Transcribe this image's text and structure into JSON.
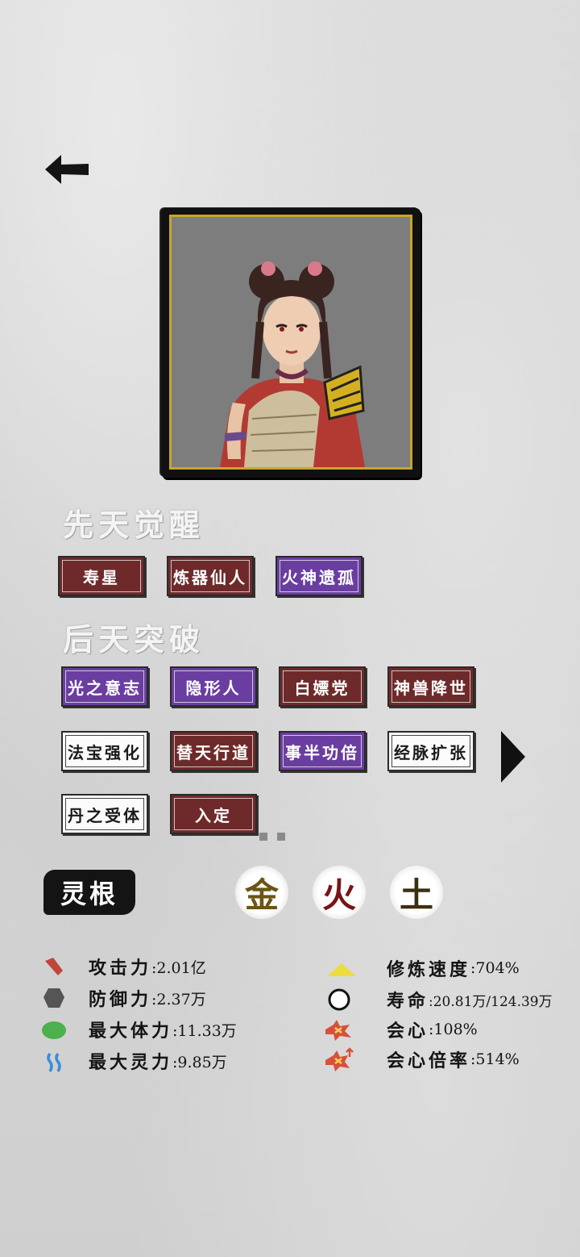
{
  "innate_awakening": {
    "title": "先天觉醒",
    "tags": [
      {
        "label": "寿星",
        "color": "red"
      },
      {
        "label": "炼器仙人",
        "color": "red"
      },
      {
        "label": "火神遗孤",
        "color": "purple"
      }
    ]
  },
  "acquired_breakthrough": {
    "title": "后天突破",
    "tags": [
      {
        "label": "光之意志",
        "color": "purple"
      },
      {
        "label": "隐形人",
        "color": "purple"
      },
      {
        "label": "白嫖党",
        "color": "red"
      },
      {
        "label": "神兽降世",
        "color": "red"
      },
      {
        "label": "法宝强化",
        "color": "white"
      },
      {
        "label": "替天行道",
        "color": "red"
      },
      {
        "label": "事半功倍",
        "color": "purple"
      },
      {
        "label": "经脉扩张",
        "color": "white"
      },
      {
        "label": "丹之受体",
        "color": "white"
      },
      {
        "label": "入定",
        "color": "red"
      }
    ]
  },
  "spirit_root": {
    "label": "灵根",
    "elements": [
      {
        "name": "金",
        "color": "#6b5414"
      },
      {
        "name": "火",
        "color": "#7a1414"
      },
      {
        "name": "土",
        "color": "#3a3010"
      }
    ]
  },
  "stats_left": [
    {
      "icon": "attack-icon",
      "label": "攻击力",
      "value": ":2.01亿"
    },
    {
      "icon": "defense-icon",
      "label": "防御力",
      "value": ":2.37万"
    },
    {
      "icon": "health-icon",
      "label": "最大体力",
      "value": ":11.33万"
    },
    {
      "icon": "spirit-icon",
      "label": "最大灵力",
      "value": ":9.85万"
    }
  ],
  "stats_right": [
    {
      "icon": "cultivation-speed-icon",
      "label": "修炼速度",
      "value": ":704%"
    },
    {
      "icon": "lifespan-icon",
      "label": "寿命",
      "value": ":20.81万/124.39万"
    },
    {
      "icon": "critical-icon",
      "label": "会心",
      "value": ":108%"
    },
    {
      "icon": "critical-multiplier-icon",
      "label": "会心倍率",
      "value": ":514%"
    }
  ]
}
